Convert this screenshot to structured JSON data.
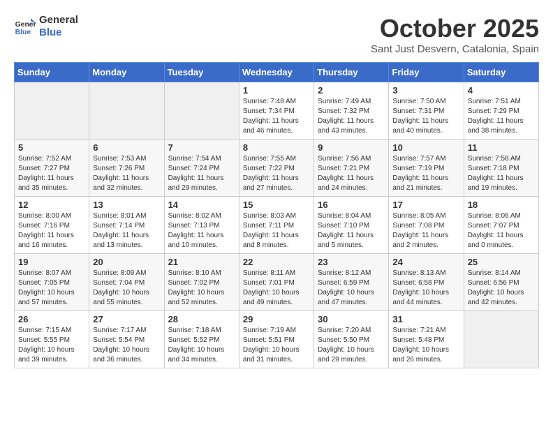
{
  "logo": {
    "general": "General",
    "blue": "Blue"
  },
  "header": {
    "month": "October 2025",
    "location": "Sant Just Desvern, Catalonia, Spain"
  },
  "weekdays": [
    "Sunday",
    "Monday",
    "Tuesday",
    "Wednesday",
    "Thursday",
    "Friday",
    "Saturday"
  ],
  "weeks": [
    [
      {
        "day": "",
        "info": ""
      },
      {
        "day": "",
        "info": ""
      },
      {
        "day": "",
        "info": ""
      },
      {
        "day": "1",
        "info": "Sunrise: 7:48 AM\nSunset: 7:34 PM\nDaylight: 11 hours and 46 minutes."
      },
      {
        "day": "2",
        "info": "Sunrise: 7:49 AM\nSunset: 7:32 PM\nDaylight: 11 hours and 43 minutes."
      },
      {
        "day": "3",
        "info": "Sunrise: 7:50 AM\nSunset: 7:31 PM\nDaylight: 11 hours and 40 minutes."
      },
      {
        "day": "4",
        "info": "Sunrise: 7:51 AM\nSunset: 7:29 PM\nDaylight: 11 hours and 38 minutes."
      }
    ],
    [
      {
        "day": "5",
        "info": "Sunrise: 7:52 AM\nSunset: 7:27 PM\nDaylight: 11 hours and 35 minutes."
      },
      {
        "day": "6",
        "info": "Sunrise: 7:53 AM\nSunset: 7:26 PM\nDaylight: 11 hours and 32 minutes."
      },
      {
        "day": "7",
        "info": "Sunrise: 7:54 AM\nSunset: 7:24 PM\nDaylight: 11 hours and 29 minutes."
      },
      {
        "day": "8",
        "info": "Sunrise: 7:55 AM\nSunset: 7:22 PM\nDaylight: 11 hours and 27 minutes."
      },
      {
        "day": "9",
        "info": "Sunrise: 7:56 AM\nSunset: 7:21 PM\nDaylight: 11 hours and 24 minutes."
      },
      {
        "day": "10",
        "info": "Sunrise: 7:57 AM\nSunset: 7:19 PM\nDaylight: 11 hours and 21 minutes."
      },
      {
        "day": "11",
        "info": "Sunrise: 7:58 AM\nSunset: 7:18 PM\nDaylight: 11 hours and 19 minutes."
      }
    ],
    [
      {
        "day": "12",
        "info": "Sunrise: 8:00 AM\nSunset: 7:16 PM\nDaylight: 11 hours and 16 minutes."
      },
      {
        "day": "13",
        "info": "Sunrise: 8:01 AM\nSunset: 7:14 PM\nDaylight: 11 hours and 13 minutes."
      },
      {
        "day": "14",
        "info": "Sunrise: 8:02 AM\nSunset: 7:13 PM\nDaylight: 11 hours and 10 minutes."
      },
      {
        "day": "15",
        "info": "Sunrise: 8:03 AM\nSunset: 7:11 PM\nDaylight: 11 hours and 8 minutes."
      },
      {
        "day": "16",
        "info": "Sunrise: 8:04 AM\nSunset: 7:10 PM\nDaylight: 11 hours and 5 minutes."
      },
      {
        "day": "17",
        "info": "Sunrise: 8:05 AM\nSunset: 7:08 PM\nDaylight: 11 hours and 2 minutes."
      },
      {
        "day": "18",
        "info": "Sunrise: 8:06 AM\nSunset: 7:07 PM\nDaylight: 11 hours and 0 minutes."
      }
    ],
    [
      {
        "day": "19",
        "info": "Sunrise: 8:07 AM\nSunset: 7:05 PM\nDaylight: 10 hours and 57 minutes."
      },
      {
        "day": "20",
        "info": "Sunrise: 8:09 AM\nSunset: 7:04 PM\nDaylight: 10 hours and 55 minutes."
      },
      {
        "day": "21",
        "info": "Sunrise: 8:10 AM\nSunset: 7:02 PM\nDaylight: 10 hours and 52 minutes."
      },
      {
        "day": "22",
        "info": "Sunrise: 8:11 AM\nSunset: 7:01 PM\nDaylight: 10 hours and 49 minutes."
      },
      {
        "day": "23",
        "info": "Sunrise: 8:12 AM\nSunset: 6:59 PM\nDaylight: 10 hours and 47 minutes."
      },
      {
        "day": "24",
        "info": "Sunrise: 8:13 AM\nSunset: 6:58 PM\nDaylight: 10 hours and 44 minutes."
      },
      {
        "day": "25",
        "info": "Sunrise: 8:14 AM\nSunset: 6:56 PM\nDaylight: 10 hours and 42 minutes."
      }
    ],
    [
      {
        "day": "26",
        "info": "Sunrise: 7:15 AM\nSunset: 5:55 PM\nDaylight: 10 hours and 39 minutes."
      },
      {
        "day": "27",
        "info": "Sunrise: 7:17 AM\nSunset: 5:54 PM\nDaylight: 10 hours and 36 minutes."
      },
      {
        "day": "28",
        "info": "Sunrise: 7:18 AM\nSunset: 5:52 PM\nDaylight: 10 hours and 34 minutes."
      },
      {
        "day": "29",
        "info": "Sunrise: 7:19 AM\nSunset: 5:51 PM\nDaylight: 10 hours and 31 minutes."
      },
      {
        "day": "30",
        "info": "Sunrise: 7:20 AM\nSunset: 5:50 PM\nDaylight: 10 hours and 29 minutes."
      },
      {
        "day": "31",
        "info": "Sunrise: 7:21 AM\nSunset: 5:48 PM\nDaylight: 10 hours and 26 minutes."
      },
      {
        "day": "",
        "info": ""
      }
    ]
  ]
}
